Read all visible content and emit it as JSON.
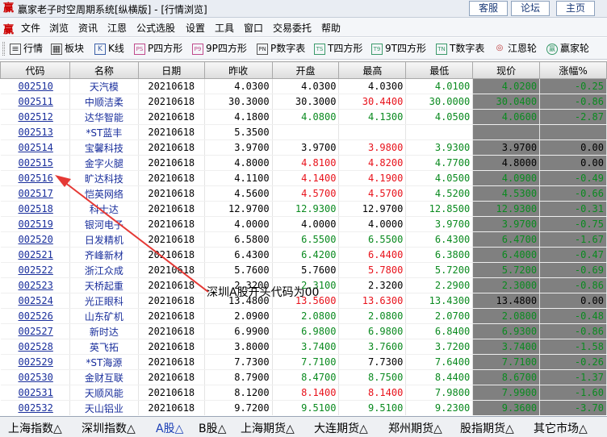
{
  "window": {
    "title": "赢家老子时空周期系统[纵横版] - [行情浏览]",
    "app_icon": "赢",
    "buttons": [
      "客服",
      "论坛",
      "主页"
    ]
  },
  "menu": {
    "icon": "赢",
    "items": [
      "文件",
      "浏览",
      "资讯",
      "江恩",
      "公式选股",
      "设置",
      "工具",
      "窗口",
      "交易委托",
      "帮助"
    ]
  },
  "toolbar": {
    "items": [
      {
        "label": "行情",
        "icon": "list-icon",
        "glyph": "≡"
      },
      {
        "label": "板块",
        "icon": "grid-icon",
        "glyph": "▦"
      },
      {
        "label": "K线",
        "icon": "candlestick-icon",
        "glyph": "K"
      },
      {
        "label": "P四方形",
        "icon": "ps-icon",
        "glyph": "PS"
      },
      {
        "label": "9P四方形",
        "icon": "p9-icon",
        "glyph": "P9"
      },
      {
        "label": "P数字表",
        "icon": "pn-icon",
        "glyph": "PN"
      },
      {
        "label": "T四方形",
        "icon": "ts-icon",
        "glyph": "TS"
      },
      {
        "label": "9T四方形",
        "icon": "t9-icon",
        "glyph": "T9"
      },
      {
        "label": "T数字表",
        "icon": "tn-icon",
        "glyph": "TN"
      },
      {
        "label": "江恩轮",
        "icon": "gann-wheel-icon",
        "glyph": "◎"
      },
      {
        "label": "赢家轮",
        "icon": "winner-wheel-icon",
        "glyph": "赢"
      }
    ]
  },
  "table": {
    "columns": [
      "代码",
      "名称",
      "日期",
      "昨收",
      "开盘",
      "最高",
      "最低",
      "现价",
      "涨幅%"
    ],
    "rows": [
      {
        "code": "002510",
        "name": "天汽模",
        "date": "20210618",
        "prev": "4.0300",
        "open": "4.0300",
        "high": "4.0300",
        "low": "4.0100",
        "price": "4.0200",
        "chg": "-0.25"
      },
      {
        "code": "002511",
        "name": "中顺洁柔",
        "date": "20210618",
        "prev": "30.3000",
        "open": "30.3000",
        "high": "30.4400",
        "low": "30.0000",
        "price": "30.0400",
        "chg": "-0.86"
      },
      {
        "code": "002512",
        "name": "达华智能",
        "date": "20210618",
        "prev": "4.1800",
        "open": "4.0800",
        "high": "4.1300",
        "low": "4.0500",
        "price": "4.0600",
        "chg": "-2.87"
      },
      {
        "code": "002513",
        "name": "*ST蓝丰",
        "date": "20210618",
        "prev": "5.3500",
        "open": "",
        "high": "",
        "low": "",
        "price": "",
        "chg": ""
      },
      {
        "code": "002514",
        "name": "宝馨科技",
        "date": "20210618",
        "prev": "3.9700",
        "open": "3.9700",
        "high": "3.9800",
        "low": "3.9300",
        "price": "3.9700",
        "chg": "0.00"
      },
      {
        "code": "002515",
        "name": "金字火腿",
        "date": "20210618",
        "prev": "4.8000",
        "open": "4.8100",
        "high": "4.8200",
        "low": "4.7700",
        "price": "4.8000",
        "chg": "0.00"
      },
      {
        "code": "002516",
        "name": "旷达科技",
        "date": "20210618",
        "prev": "4.1100",
        "open": "4.1400",
        "high": "4.1900",
        "low": "4.0500",
        "price": "4.0900",
        "chg": "-0.49"
      },
      {
        "code": "002517",
        "name": "恺英网络",
        "date": "20210618",
        "prev": "4.5600",
        "open": "4.5700",
        "high": "4.5700",
        "low": "4.5200",
        "price": "4.5300",
        "chg": "-0.66"
      },
      {
        "code": "002518",
        "name": "科士达",
        "date": "20210618",
        "prev": "12.9700",
        "open": "12.9300",
        "high": "12.9700",
        "low": "12.8500",
        "price": "12.9300",
        "chg": "-0.31"
      },
      {
        "code": "002519",
        "name": "银河电子",
        "date": "20210618",
        "prev": "4.0000",
        "open": "4.0000",
        "high": "4.0000",
        "low": "3.9700",
        "price": "3.9700",
        "chg": "-0.75"
      },
      {
        "code": "002520",
        "name": "日发精机",
        "date": "20210618",
        "prev": "6.5800",
        "open": "6.5500",
        "high": "6.5500",
        "low": "6.4300",
        "price": "6.4700",
        "chg": "-1.67"
      },
      {
        "code": "002521",
        "name": "齐峰新材",
        "date": "20210618",
        "prev": "6.4300",
        "open": "6.4200",
        "high": "6.4400",
        "low": "6.3800",
        "price": "6.4000",
        "chg": "-0.47"
      },
      {
        "code": "002522",
        "name": "浙江众成",
        "date": "20210618",
        "prev": "5.7600",
        "open": "5.7600",
        "high": "5.7800",
        "low": "5.7200",
        "price": "5.7200",
        "chg": "-0.69"
      },
      {
        "code": "002523",
        "name": "天桥起重",
        "date": "20210618",
        "prev": "2.3200",
        "open": "2.3100",
        "high": "2.3200",
        "low": "2.2900",
        "price": "2.3000",
        "chg": "-0.86"
      },
      {
        "code": "002524",
        "name": "光正眼科",
        "date": "20210618",
        "prev": "13.4800",
        "open": "13.5600",
        "high": "13.6300",
        "low": "13.4300",
        "price": "13.4800",
        "chg": "0.00"
      },
      {
        "code": "002526",
        "name": "山东矿机",
        "date": "20210618",
        "prev": "2.0900",
        "open": "2.0800",
        "high": "2.0800",
        "low": "2.0700",
        "price": "2.0800",
        "chg": "-0.48"
      },
      {
        "code": "002527",
        "name": "新时达",
        "date": "20210618",
        "prev": "6.9900",
        "open": "6.9800",
        "high": "6.9800",
        "low": "6.8400",
        "price": "6.9300",
        "chg": "-0.86"
      },
      {
        "code": "002528",
        "name": "英飞拓",
        "date": "20210618",
        "prev": "3.8000",
        "open": "3.7400",
        "high": "3.7600",
        "low": "3.7200",
        "price": "3.7400",
        "chg": "-1.58"
      },
      {
        "code": "002529",
        "name": "*ST海源",
        "date": "20210618",
        "prev": "7.7300",
        "open": "7.7100",
        "high": "7.7300",
        "low": "7.6400",
        "price": "7.7100",
        "chg": "-0.26"
      },
      {
        "code": "002530",
        "name": "金财互联",
        "date": "20210618",
        "prev": "8.7900",
        "open": "8.4700",
        "high": "8.7500",
        "low": "8.4400",
        "price": "8.6700",
        "chg": "-1.37"
      },
      {
        "code": "002531",
        "name": "天顺风能",
        "date": "20210618",
        "prev": "8.1200",
        "open": "8.1400",
        "high": "8.1400",
        "low": "7.9800",
        "price": "7.9900",
        "chg": "-1.60"
      },
      {
        "code": "002532",
        "name": "天山铝业",
        "date": "20210618",
        "prev": "9.7200",
        "open": "9.5100",
        "high": "9.5100",
        "low": "9.2300",
        "price": "9.3600",
        "chg": "-3.70"
      }
    ]
  },
  "tabs": [
    "上海指数△",
    "深圳指数△",
    "A股△",
    "B股△",
    "上海期货△",
    "大连期货△",
    "郑州期货△",
    "股指期货△",
    "其它市场△"
  ],
  "active_tab": 2,
  "annotation": "深圳A股开头代码为00",
  "colors": {
    "up": "#e8121b",
    "down": "#0a8a1f",
    "link": "#1a2f9c",
    "arrow": "#e53935",
    "current_price_bg": "#808080"
  }
}
